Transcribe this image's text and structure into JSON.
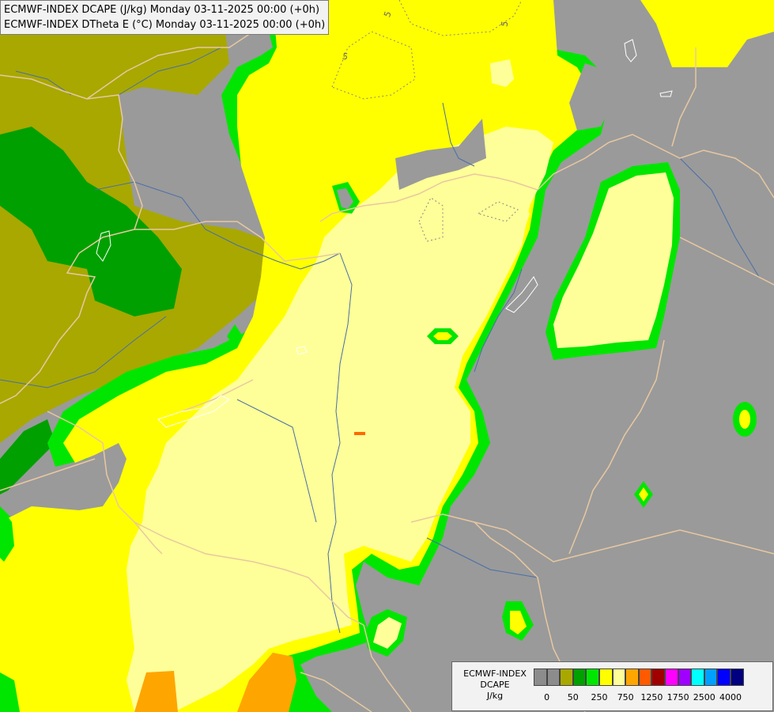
{
  "titles": {
    "line1": "ECMWF-INDEX DCAPE (J/kg) Monday 03-11-2025 00:00 (+0h)",
    "line2": "ECMWF-INDEX DTheta E (°C) Monday 03-11-2025 00:00 (+0h)"
  },
  "contour_labels": [
    "5",
    "5",
    "5"
  ],
  "legend": {
    "name_line1": "ECMWF-INDEX",
    "name_line2": "DCAPE",
    "unit": "J/kg",
    "colors": [
      "#8c8c8c",
      "#8c8c8c",
      "#a8a800",
      "#00a000",
      "#00e600",
      "#ffff00",
      "#ffff99",
      "#ffa500",
      "#ff5a00",
      "#a00000",
      "#ff00ff",
      "#a000ff",
      "#00ffff",
      "#00a0ff",
      "#0000ff",
      "#000080"
    ],
    "ticks": [
      "0",
      "50",
      "250",
      "750",
      "1250",
      "1750",
      "2500",
      "4000"
    ]
  },
  "map_colors": {
    "background": "#9a9a9a",
    "olive": "#a8a800",
    "dark_green": "#00a000",
    "bright_green": "#00e600",
    "yellow": "#ffff00",
    "light_yellow": "#ffff99",
    "orange": "#ffa500",
    "border_line": "#e8c8a0",
    "river": "#4a6ea8"
  }
}
